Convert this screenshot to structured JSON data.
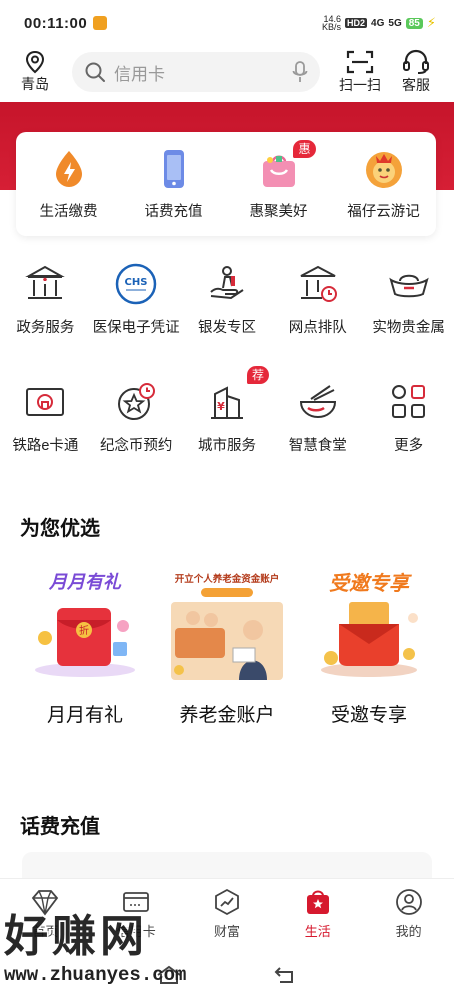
{
  "status_bar": {
    "time": "00:11:00",
    "net_speed_value": "14.6",
    "net_speed_unit": "KB/s",
    "hd_label": "HD",
    "hd_index": "2",
    "signal_1": "4G",
    "signal_2": "5G",
    "battery": "85"
  },
  "header": {
    "location": "青岛",
    "search_placeholder": "信用卡",
    "scan_label": "扫一扫",
    "service_label": "客服"
  },
  "quick_services": [
    {
      "label": "生活缴费",
      "icon": "flame-droplet-icon"
    },
    {
      "label": "话费充值",
      "icon": "phone-icon"
    },
    {
      "label": "惠聚美好",
      "icon": "shopping-bag-icon",
      "badge": "惠"
    },
    {
      "label": "福仔云游记",
      "icon": "mascot-icon"
    }
  ],
  "services": [
    {
      "label": "政务服务",
      "icon": "government-building-icon"
    },
    {
      "label": "医保电子凭证",
      "icon": "chs-medical-icon",
      "icon_text": "CHS"
    },
    {
      "label": "银发专区",
      "icon": "elder-care-icon"
    },
    {
      "label": "网点排队",
      "icon": "branch-queue-icon"
    },
    {
      "label": "实物贵金属",
      "icon": "gold-ingot-icon"
    },
    {
      "label": "铁路e卡通",
      "icon": "railway-card-icon"
    },
    {
      "label": "纪念币预约",
      "icon": "coin-reserve-icon"
    },
    {
      "label": "城市服务",
      "icon": "city-service-icon",
      "badge": "荐"
    },
    {
      "label": "智慧食堂",
      "icon": "canteen-bowl-icon"
    },
    {
      "label": "更多",
      "icon": "more-grid-icon"
    }
  ],
  "recommend": {
    "title": "为您优选",
    "items": [
      {
        "label": "月月有礼",
        "banner": "月月有礼"
      },
      {
        "label": "养老金账户",
        "banner": "开立个人养老金资金账户"
      },
      {
        "label": "受邀专享",
        "banner": "受邀专享"
      }
    ]
  },
  "recharge": {
    "title": "话费充值"
  },
  "tabbar": [
    {
      "label": "首页",
      "icon": "diamond-icon",
      "active": false
    },
    {
      "label": "信用卡",
      "icon": "credit-card-icon",
      "active": false
    },
    {
      "label": "财富",
      "icon": "wealth-chart-icon",
      "active": false
    },
    {
      "label": "生活",
      "icon": "life-bag-icon",
      "active": true
    },
    {
      "label": "我的",
      "icon": "profile-icon",
      "active": false
    }
  ],
  "watermark": {
    "text": "好赚网",
    "url": "www.zhuanyes.com"
  },
  "colors": {
    "brand_red": "#d6192e",
    "icon_red": "#d62b3a",
    "icon_dark": "#333333"
  }
}
